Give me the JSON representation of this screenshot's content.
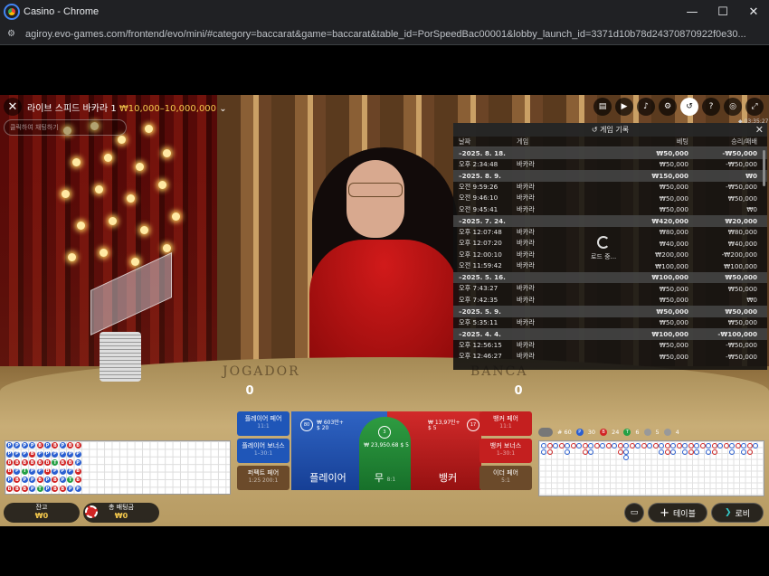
{
  "window": {
    "title": "Casino - Chrome",
    "minimize": "—",
    "maximize": "☐",
    "close": "✕"
  },
  "address": {
    "url": "agiroy.evo-games.com/frontend/evo/mini/#category=baccarat&game=baccarat&table_id=PorSpeedBac00001&lobby_launch_id=3371d10b78d24370870922f0e30..."
  },
  "game": {
    "title": "라이브 스피드 바카라 1",
    "limits": "₩10,000–10,000,000",
    "chat_placeholder": "클릭하여 채팅하기",
    "clock": "◆ 03:35:27",
    "table_left_label": "JOGADOR",
    "table_right_label": "BANCA",
    "player_score": "0",
    "banker_score": "0"
  },
  "history": {
    "title": "게임 기록",
    "columns": {
      "date": "날짜",
      "game": "게임",
      "bet": "베팅",
      "result": "승리/패배"
    },
    "loading": "로드 중...",
    "rows": [
      {
        "type": "date",
        "time": "–2025. 8. 18.",
        "game": "",
        "bet": "₩50,000",
        "result": "-₩50,000"
      },
      {
        "type": "item",
        "time": "오후 2:34:48",
        "game": "바카라",
        "bet": "₩50,000",
        "result": "-₩50,000"
      },
      {
        "type": "date",
        "time": "–2025. 8. 9.",
        "game": "",
        "bet": "₩150,000",
        "result": "₩0"
      },
      {
        "type": "item",
        "time": "오전 9:59:26",
        "game": "바카라",
        "bet": "₩50,000",
        "result": "-₩50,000"
      },
      {
        "type": "item",
        "time": "오전 9:46:10",
        "game": "바카라",
        "bet": "₩50,000",
        "result": "₩50,000"
      },
      {
        "type": "item",
        "time": "오전 9:45:41",
        "game": "바카라",
        "bet": "₩50,000",
        "result": "₩0"
      },
      {
        "type": "date",
        "time": "–2025. 7. 24.",
        "game": "",
        "bet": "₩420,000",
        "result": "₩20,000"
      },
      {
        "type": "item",
        "time": "오후 12:07:48",
        "game": "바카라",
        "bet": "₩80,000",
        "result": "₩80,000"
      },
      {
        "type": "item",
        "time": "오후 12:07:20",
        "game": "바카라",
        "bet": "₩40,000",
        "result": "₩40,000"
      },
      {
        "type": "item",
        "time": "오후 12:00:10",
        "game": "바카라",
        "bet": "₩200,000",
        "result": "-₩200,000"
      },
      {
        "type": "item",
        "time": "오전 11:59:42",
        "game": "바카라",
        "bet": "₩100,000",
        "result": "₩100,000"
      },
      {
        "type": "date",
        "time": "–2025. 5. 16.",
        "game": "",
        "bet": "₩100,000",
        "result": "₩50,000"
      },
      {
        "type": "item",
        "time": "오후 7:43:27",
        "game": "바카라",
        "bet": "₩50,000",
        "result": "₩50,000"
      },
      {
        "type": "item",
        "time": "오후 7:42:35",
        "game": "바카라",
        "bet": "₩50,000",
        "result": "₩0"
      },
      {
        "type": "date",
        "time": "–2025. 5. 9.",
        "game": "",
        "bet": "₩50,000",
        "result": "₩50,000"
      },
      {
        "type": "item",
        "time": "오후 5:35:11",
        "game": "바카라",
        "bet": "₩50,000",
        "result": "₩50,000"
      },
      {
        "type": "date",
        "time": "–2025. 4. 4.",
        "game": "",
        "bet": "₩100,000",
        "result": "-₩100,000"
      },
      {
        "type": "item",
        "time": "오후 12:56:15",
        "game": "바카라",
        "bet": "₩50,000",
        "result": "-₩50,000"
      },
      {
        "type": "item",
        "time": "오후 12:46:27",
        "game": "바카라",
        "bet": "₩50,000",
        "result": "-₩50,000"
      }
    ]
  },
  "bets": {
    "player_pair": "플레이어 페어",
    "player_pair_odds": "11:1",
    "player_bonus": "플레이어 보너스",
    "player_bonus_odds": "1–30:1",
    "perfect_pair": "퍼펙트 페어",
    "perfect_pair_odds": "1:25 200:1",
    "player": "플레이어",
    "player_stat_amount": "₩ 603만+",
    "player_stat_count": "$ 20",
    "player_pct": "80",
    "tie": "무",
    "tie_odds": "8:1",
    "tie_stat": "₩ 23,950.68 $ 5",
    "tie_pct": "3",
    "banker": "뱅커",
    "banker_stat_amount": "₩ 13,97만+",
    "banker_stat_count": "$ 5",
    "banker_pct": "17",
    "banker_pair": "뱅커 페어",
    "banker_pair_odds": "11:1",
    "banker_bonus": "뱅커 보너스",
    "banker_bonus_odds": "1–30:1",
    "either_pair": "이더 페어",
    "either_pair_odds": "5:1"
  },
  "road_stats": {
    "total": "# 60",
    "player": "30",
    "banker": "24",
    "tie": "6",
    "player_pair": "5",
    "banker_pair": "4"
  },
  "footer": {
    "balance_label": "잔고",
    "balance_value": "₩0",
    "total_bet_label": "총 배팅금",
    "total_bet_value": "₩0",
    "table_button": "테이블",
    "lobby_button": "로비"
  },
  "colors": {
    "player": "#2a5fd1",
    "banker": "#d12424",
    "tie": "#24a045",
    "gold": "#f5c94c"
  },
  "bead_road": [
    "P",
    "P",
    "B",
    "B",
    "P",
    "B",
    "P",
    "P",
    "B",
    "P",
    "B",
    "B",
    "P",
    "P",
    "B",
    "T",
    "P",
    "B",
    "P",
    "B",
    "B",
    "P",
    "P",
    "P",
    "B",
    "P",
    "B",
    "P",
    "B",
    "T",
    "P",
    "P",
    "B",
    "B",
    "P",
    "P",
    "B",
    "P",
    "T",
    "P",
    "B",
    "B",
    "P",
    "P",
    "B",
    "P",
    "P",
    "B",
    "B",
    "P",
    "B",
    "P",
    "T",
    "P",
    "B",
    "P",
    "P",
    "B",
    "B",
    "P"
  ]
}
